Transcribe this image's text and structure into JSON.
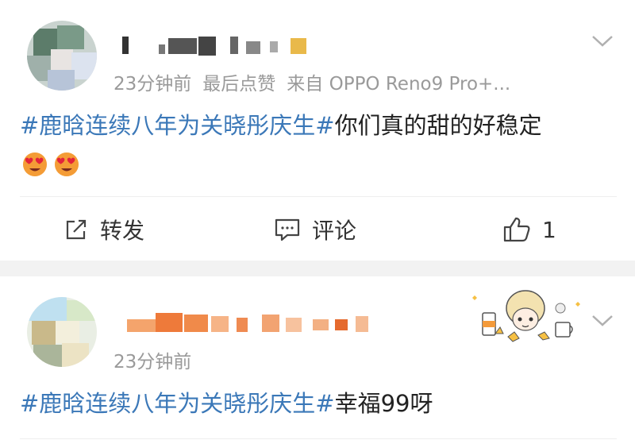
{
  "posts": [
    {
      "meta": {
        "time": "23分钟前",
        "like_status": "最后点赞",
        "source": "来自 OPPO Reno9 Pro+..."
      },
      "content": {
        "hashtag": "#鹿晗连续八年为关晓彤庆生#",
        "text": "你们真的甜的好稳定"
      },
      "emojis": [
        "heart-eyes-emoji",
        "heart-eyes-emoji"
      ],
      "actions": {
        "repost_label": "转发",
        "comment_label": "评论",
        "like_count": "1"
      }
    },
    {
      "meta": {
        "time": "23分钟前"
      },
      "content": {
        "hashtag": "#鹿晗连续八年为关晓彤庆生#",
        "text": "幸福99呀"
      }
    }
  ],
  "icons": {
    "repost": "repost-icon",
    "comment": "comment-icon",
    "like": "thumbs-up-icon",
    "more": "chevron-down-icon"
  },
  "colors": {
    "hashtag": "#3b78b8",
    "meta": "#9a9a9a",
    "separator": "#f2f2f2"
  }
}
